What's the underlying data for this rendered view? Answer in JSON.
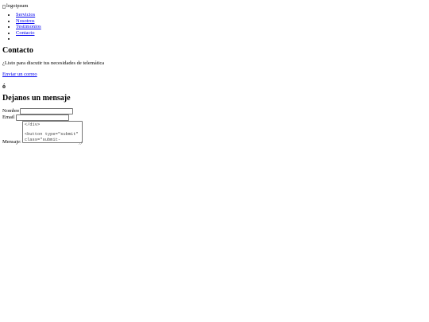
{
  "logo": {
    "alt": "logoipsum"
  },
  "nav": {
    "items": [
      {
        "label": "Servicios"
      },
      {
        "label": "Nosotros"
      },
      {
        "label": "Testimonios"
      },
      {
        "label": "Contacto"
      },
      {
        "label": ""
      }
    ]
  },
  "contact": {
    "title": "Contacto",
    "lead": "¿Listo para discutir tus necesidades de telemática",
    "email_link": "Enviar un correo",
    "or": "ó"
  },
  "form": {
    "title": "Dejanos un mensaje",
    "name_label": "Nombre",
    "name_value": "",
    "email_label": "Email",
    "email_value": "",
    "message_label": "Mensaje:",
    "message_value": "</div>\n\n<button type=\"submit\" class=\"submit-"
  },
  "colors": {
    "link": "#0000ee",
    "text": "#000000",
    "background": "#ffffff"
  }
}
